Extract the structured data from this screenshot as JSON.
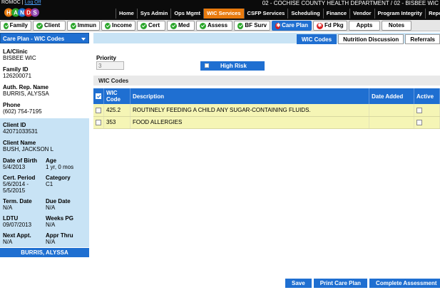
{
  "header": {
    "user": "ROMOC",
    "logoff_label": "Log Off",
    "logo_letters": [
      "H",
      "A",
      "N",
      "D",
      "S"
    ],
    "title": "02 - COCHISE COUNTY HEALTH DEPARTMENT / 02 - BISBEE WIC"
  },
  "top_nav": [
    {
      "label": "Home",
      "active": false
    },
    {
      "label": "Sys Admin",
      "active": false
    },
    {
      "label": "Ops Mgmt",
      "active": false
    },
    {
      "label": "WIC Services",
      "active": true
    },
    {
      "label": "CSFP Services",
      "active": false
    },
    {
      "label": "Scheduling",
      "active": false
    },
    {
      "label": "Finance",
      "active": false
    },
    {
      "label": "Vendor",
      "active": false
    },
    {
      "label": "Program Integrity",
      "active": false
    },
    {
      "label": "Reports",
      "active": false
    }
  ],
  "sub_tabs": [
    {
      "label": "Family",
      "status": "ok"
    },
    {
      "label": "Client",
      "status": "ok"
    },
    {
      "label": "Immun",
      "status": "ok"
    },
    {
      "label": "Income",
      "status": "ok"
    },
    {
      "label": "Cert",
      "status": "ok"
    },
    {
      "label": "Med",
      "status": "ok"
    },
    {
      "label": "Assess",
      "status": "ok"
    },
    {
      "label": "BF Surv",
      "status": "ok"
    },
    {
      "label": "Care Plan",
      "status": "error",
      "active": true
    },
    {
      "label": "Fd Pkg",
      "status": "error"
    },
    {
      "label": "Appts",
      "status": "none"
    },
    {
      "label": "Notes",
      "status": "none"
    }
  ],
  "sidebar": {
    "dropdown_label": "Care Plan - WIC Codes",
    "la_clinic_label": "LA/Clinic",
    "la_clinic": "BISBEE WIC",
    "family_id_label": "Family ID",
    "family_id": "126200071",
    "auth_rep_label": "Auth. Rep. Name",
    "auth_rep": "BURRIS, ALYSSA",
    "phone_label": "Phone",
    "phone": "(602) 754-7195",
    "client_id_label": "Client ID",
    "client_id": "42071033531",
    "client_name_label": "Client Name",
    "client_name": "BUSH, JACKSON L",
    "dob_label": "Date of Birth",
    "dob": "5/4/2013",
    "age_label": "Age",
    "age": "1 yr, 0 mos",
    "cert_period_label": "Cert. Period",
    "cert_period_start": "5/6/2014 -",
    "cert_period_end": "5/5/2015",
    "category_label": "Category",
    "category": "C1",
    "term_date_label": "Term. Date",
    "term_date": "N/A",
    "due_date_label": "Due Date",
    "due_date": "N/A",
    "ldtu_label": "LDTU",
    "ldtu": "09/07/2013",
    "weeks_pg_label": "Weeks PG",
    "weeks_pg": "N/A",
    "next_appt_label": "Next Appt.",
    "next_appt": "N/A",
    "appr_thru_label": "Appr Thru",
    "appr_thru": "N/A",
    "name_bar": "BURRIS, ALYSSA"
  },
  "right_tabs": [
    {
      "label": "WIC Codes",
      "active": true
    },
    {
      "label": "Nutrition Discussion",
      "active": false
    },
    {
      "label": "Referrals",
      "active": false
    }
  ],
  "priority": {
    "label": "Priority",
    "value": "3"
  },
  "high_risk_label": "High Risk",
  "wic_codes": {
    "panel_title": "WIC Codes",
    "headers": {
      "code": "WIC Code",
      "description": "Description",
      "date_added": "Date Added",
      "active": "Active"
    },
    "rows": [
      {
        "code": "425.2",
        "description": "ROUTINELY FEEDING A CHILD ANY SUGAR-CONTAINING FLUIDS.",
        "date_added": ""
      },
      {
        "code": "353",
        "description": "FOOD ALLERGIES",
        "date_added": ""
      }
    ]
  },
  "buttons": {
    "save": "Save",
    "print_care_plan": "Print Care Plan",
    "complete_assessment": "Complete Assessment"
  },
  "colors": {
    "accent_blue": "#1f6fd1",
    "active_orange": "#e87a0e",
    "row_yellow": "#f5f5b5",
    "client_panel": "#c8e3f5"
  }
}
